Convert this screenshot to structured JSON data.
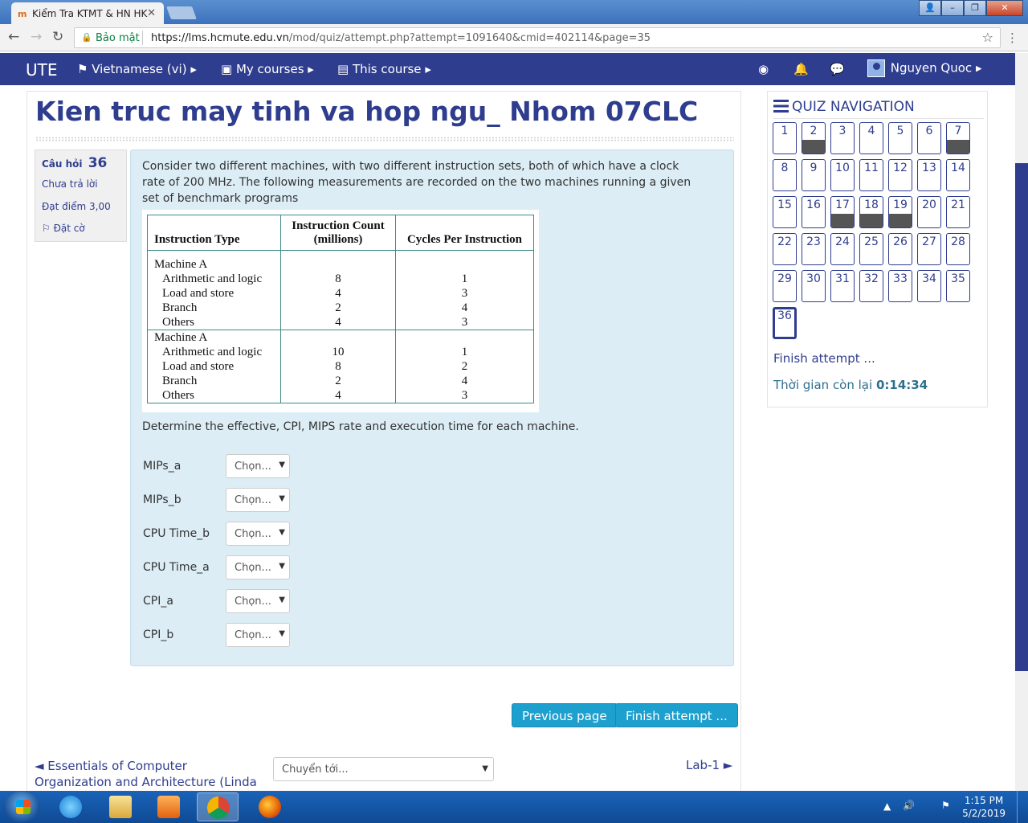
{
  "browser": {
    "tab_title": "Kiểm Tra KTMT & HN HK",
    "tab_favicon": "m",
    "secure_label": "Bảo mật",
    "url_host": "https://lms.hcmute.edu.vn",
    "url_path": "/mod/quiz/attempt.php?attempt=1091640&cmid=402114&page=35"
  },
  "navbar": {
    "brand": "UTE",
    "language": "Vietnamese (vi)",
    "my_courses": "My courses",
    "this_course": "This course",
    "user_name": "Nguyen Quoc"
  },
  "page": {
    "title": "Kien truc may tinh va hop ngu_ Nhom 07CLC"
  },
  "question_info": {
    "label": "Câu hỏi",
    "number": "36",
    "state": "Chưa trả lời",
    "grade": "Đạt điểm 3,00",
    "flag": "Đặt cờ"
  },
  "question": {
    "text": "Consider two different machines, with two different instruction sets, both of which have a clock rate of 200 MHz. The following measurements are recorded on the two machines running a given set of benchmark programs",
    "table": {
      "headers": [
        "Instruction Type",
        "Instruction Count (millions)",
        "Cycles Per Instruction"
      ],
      "groups": [
        {
          "machine": "Machine A",
          "rows": [
            {
              "type": "Arithmetic and logic",
              "count": "8",
              "cpi": "1"
            },
            {
              "type": "Load and store",
              "count": "4",
              "cpi": "3"
            },
            {
              "type": "Branch",
              "count": "2",
              "cpi": "4"
            },
            {
              "type": "Others",
              "count": "4",
              "cpi": "3"
            }
          ]
        },
        {
          "machine": "Machine A",
          "rows": [
            {
              "type": "Arithmetic and logic",
              "count": "10",
              "cpi": "1"
            },
            {
              "type": "Load and store",
              "count": "8",
              "cpi": "2"
            },
            {
              "type": "Branch",
              "count": "2",
              "cpi": "4"
            },
            {
              "type": "Others",
              "count": "4",
              "cpi": "3"
            }
          ]
        }
      ]
    },
    "prompt": "Determine the effective, CPI, MIPS rate and execution time for each machine.",
    "answers": [
      {
        "label": "MIPs_a",
        "value": "Chọn..."
      },
      {
        "label": "MIPs_b",
        "value": "Chọn..."
      },
      {
        "label": "CPU Time_b",
        "value": "Chọn..."
      },
      {
        "label": "CPU Time_a",
        "value": "Chọn..."
      },
      {
        "label": "CPI_a",
        "value": "Chọn..."
      },
      {
        "label": "CPI_b",
        "value": "Chọn..."
      }
    ]
  },
  "buttons": {
    "previous": "Previous page",
    "finish": "Finish attempt ..."
  },
  "footer_nav": {
    "prev_link": "◄ Essentials of Computer Organization and Architecture (Linda Null & Julia",
    "jump_placeholder": "Chuyển tới...",
    "next_link": "Lab-1 ►"
  },
  "quiz_nav": {
    "title": "QUIZ NAVIGATION",
    "questions": [
      {
        "n": "1",
        "answered": false
      },
      {
        "n": "2",
        "answered": true
      },
      {
        "n": "3",
        "answered": false
      },
      {
        "n": "4",
        "answered": false
      },
      {
        "n": "5",
        "answered": false
      },
      {
        "n": "6",
        "answered": false
      },
      {
        "n": "7",
        "answered": true
      },
      {
        "n": "8",
        "answered": false
      },
      {
        "n": "9",
        "answered": false
      },
      {
        "n": "10",
        "answered": false
      },
      {
        "n": "11",
        "answered": false
      },
      {
        "n": "12",
        "answered": false
      },
      {
        "n": "13",
        "answered": false
      },
      {
        "n": "14",
        "answered": false
      },
      {
        "n": "15",
        "answered": false
      },
      {
        "n": "16",
        "answered": false
      },
      {
        "n": "17",
        "answered": true
      },
      {
        "n": "18",
        "answered": true
      },
      {
        "n": "19",
        "answered": true
      },
      {
        "n": "20",
        "answered": false
      },
      {
        "n": "21",
        "answered": false
      },
      {
        "n": "22",
        "answered": false
      },
      {
        "n": "23",
        "answered": false
      },
      {
        "n": "24",
        "answered": false
      },
      {
        "n": "25",
        "answered": false
      },
      {
        "n": "26",
        "answered": false
      },
      {
        "n": "27",
        "answered": false
      },
      {
        "n": "28",
        "answered": false
      },
      {
        "n": "29",
        "answered": false
      },
      {
        "n": "30",
        "answered": false
      },
      {
        "n": "31",
        "answered": false
      },
      {
        "n": "32",
        "answered": false
      },
      {
        "n": "33",
        "answered": false
      },
      {
        "n": "34",
        "answered": false
      },
      {
        "n": "35",
        "answered": false
      },
      {
        "n": "36",
        "answered": false,
        "current": true
      }
    ],
    "finish_link": "Finish attempt ...",
    "timer_label": "Thời gian còn lại",
    "timer_value": "0:14:34"
  },
  "taskbar": {
    "time": "1:15 PM",
    "date": "5/2/2019"
  }
}
